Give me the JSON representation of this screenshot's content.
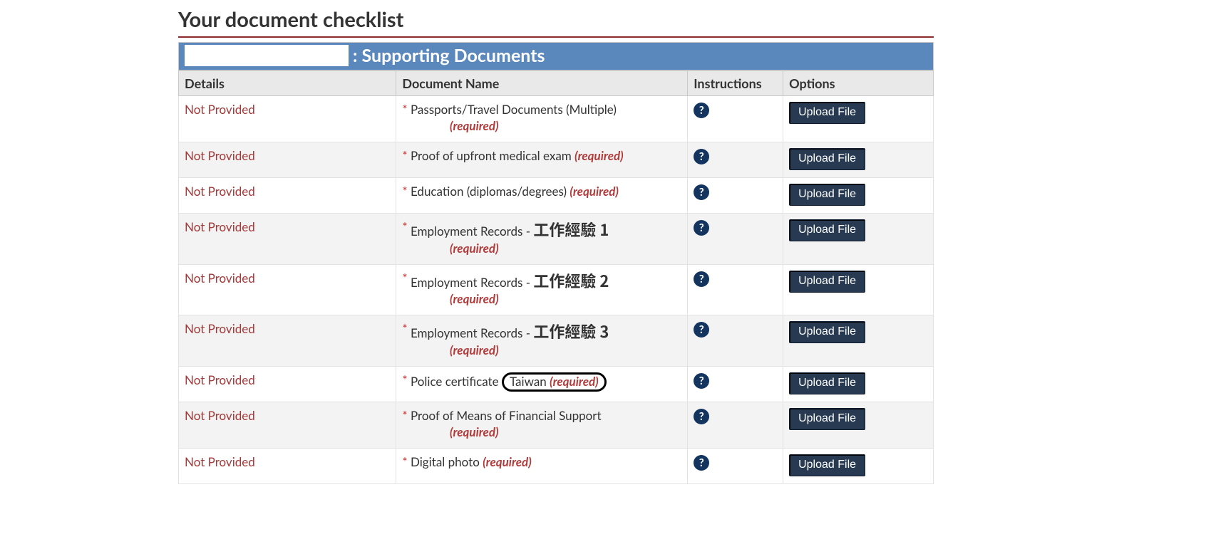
{
  "page_title": "Your document checklist",
  "section_title_suffix": ": Supporting Documents",
  "columns": {
    "details": "Details",
    "document_name": "Document Name",
    "instructions": "Instructions",
    "options": "Options"
  },
  "labels": {
    "not_provided": "Not Provided",
    "required": "(required)",
    "upload": "Upload File",
    "help": "?"
  },
  "rows": [
    {
      "status": "Not Provided",
      "name": "Passports/Travel Documents (Multiple)",
      "suffix": "",
      "required_below": true,
      "circled": false,
      "alt": false
    },
    {
      "status": "Not Provided",
      "name": "Proof of upfront medical exam",
      "suffix": "",
      "required_below": false,
      "circled": false,
      "alt": true
    },
    {
      "status": "Not Provided",
      "name": "Education (diplomas/degrees)",
      "suffix": "",
      "required_below": false,
      "circled": false,
      "alt": false
    },
    {
      "status": "Not Provided",
      "name": "Employment Records -",
      "suffix": "工作經驗 1",
      "required_below": true,
      "circled": false,
      "alt": true
    },
    {
      "status": "Not Provided",
      "name": "Employment Records -",
      "suffix": "工作經驗 2",
      "required_below": true,
      "circled": false,
      "alt": false
    },
    {
      "status": "Not Provided",
      "name": "Employment Records -",
      "suffix": "工作經驗 3",
      "required_below": true,
      "circled": false,
      "alt": true
    },
    {
      "status": "Not Provided",
      "name": "Police certificate",
      "suffix": "Taiwan",
      "required_below": false,
      "circled": true,
      "alt": false
    },
    {
      "status": "Not Provided",
      "name": "Proof of Means of Financial Support",
      "suffix": "",
      "required_below": true,
      "circled": false,
      "alt": true
    },
    {
      "status": "Not Provided",
      "name": "Digital photo",
      "suffix": "",
      "required_below": false,
      "circled": false,
      "alt": false
    }
  ]
}
